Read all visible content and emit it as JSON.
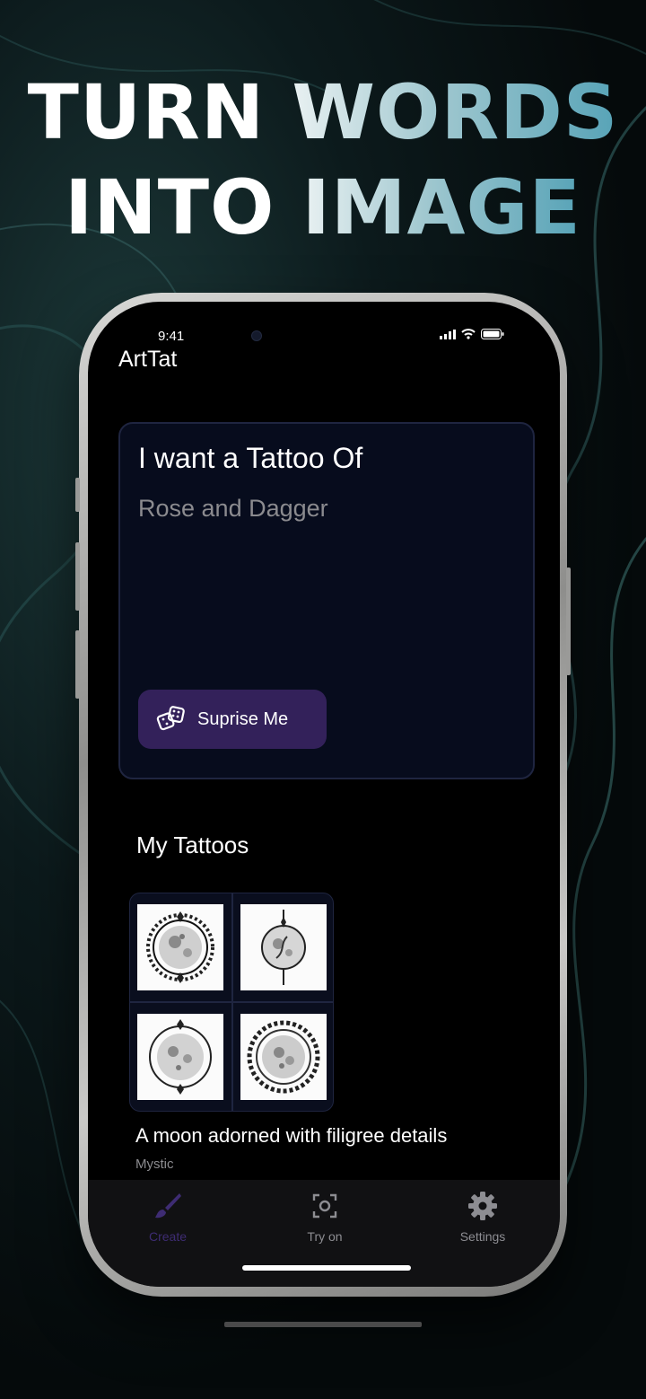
{
  "headline": {
    "line1_white": "TURN",
    "line1_accent": "WORDS",
    "line2_white": "INTO",
    "line2_accent": "IMAGE"
  },
  "status_bar": {
    "time": "9:41"
  },
  "app": {
    "title": "ArtTat"
  },
  "prompt": {
    "heading": "I want a Tattoo Of",
    "placeholder": "Rose and Dagger",
    "surprise_label": "Suprise Me"
  },
  "my_tattoos": {
    "title": "My Tattoos",
    "items": [
      {
        "title": "A moon adorned with filigree details",
        "style": "Mystic"
      }
    ]
  },
  "tab_bar": {
    "tabs": [
      {
        "label": "Create",
        "icon": "brush-icon",
        "active": true
      },
      {
        "label": "Try on",
        "icon": "camera-scan-icon",
        "active": false
      },
      {
        "label": "Settings",
        "icon": "gear-icon",
        "active": false
      }
    ]
  },
  "colors": {
    "accent_purple": "#33215a",
    "active_tab": "#3e2c73",
    "inactive_tab": "#8d8d92"
  }
}
